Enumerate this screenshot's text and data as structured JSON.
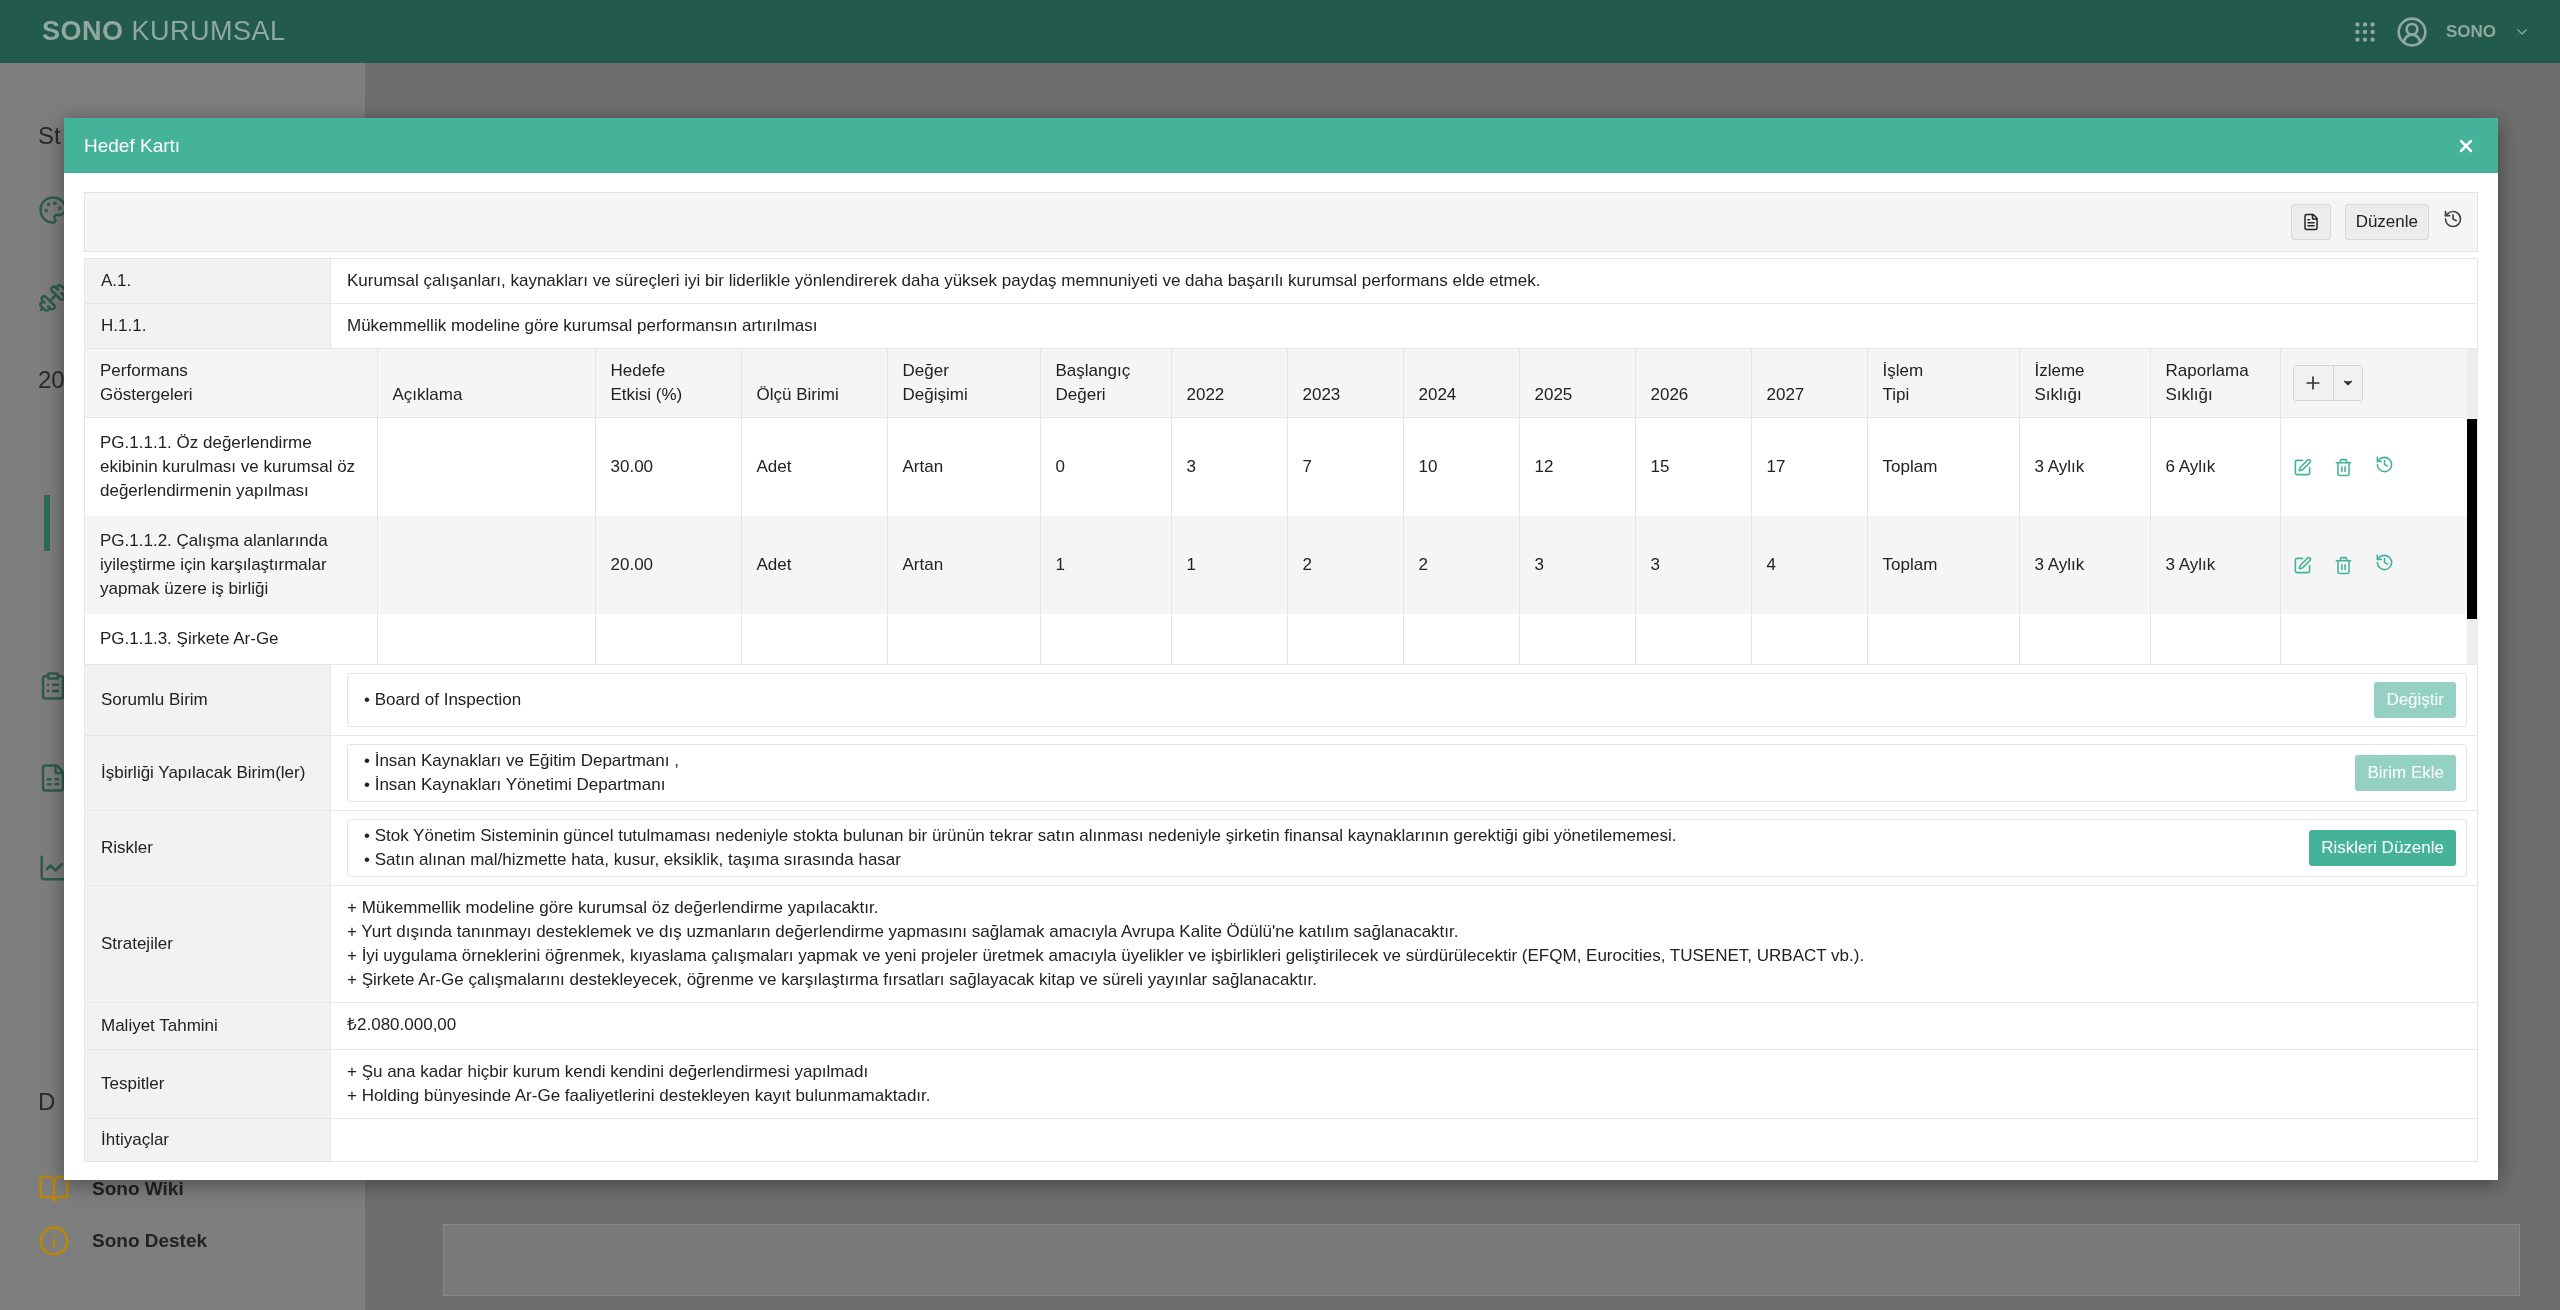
{
  "app_bar": {
    "brand_bold": "SONO",
    "brand_light": "KURUMSAL",
    "user": "SONO"
  },
  "sidebar": {
    "heading_top": "St",
    "year_text": "20",
    "heading_bottom": "D",
    "links": [
      "Sono Wiki",
      "Sono Destek"
    ]
  },
  "modal": {
    "title": "Hedef Kartı",
    "edit_button": "Düzenle",
    "goal_rows": [
      {
        "code": "A.1.",
        "text": "Kurumsal çalışanları, kaynakları ve süreçleri iyi bir liderlikle yönlendirerek daha yüksek paydaş memnuniyeti ve daha başarılı kurumsal performans elde etmek."
      },
      {
        "code": "H.1.1.",
        "text": "Mükemmellik modeline göre kurumsal performansın artırılması"
      }
    ],
    "indicator_columns": [
      "Performans\nGöstergeleri",
      "Açıklama",
      "Hedefe\nEtkisi (%)",
      "Ölçü Birimi",
      "Değer\nDeğişimi",
      "Başlangıç\nDeğeri",
      "2022",
      "2023",
      "2024",
      "2025",
      "2026",
      "2027",
      "İşlem\nTipi",
      "İzleme\nSıklığı",
      "Raporlama\nSıklığı"
    ],
    "indicator_rows": [
      {
        "name": "PG.1.1.1. Öz değerlendirme ekibinin kurulması ve kurumsal öz değerlendirmenin yapılması",
        "impact": "30.00",
        "unit": "Adet",
        "change": "Artan",
        "baseline": "0",
        "targets": [
          "3",
          "7",
          "10",
          "12",
          "15",
          "17"
        ],
        "operation": "Toplam",
        "monitoring": "3 Aylık",
        "reporting": "6 Aylık"
      },
      {
        "name": "PG.1.1.2. Çalışma alanlarında iyileştirme için karşılaştırmalar yapmak üzere iş birliği",
        "impact": "20.00",
        "unit": "Adet",
        "change": "Artan",
        "baseline": "1",
        "targets": [
          "1",
          "2",
          "2",
          "3",
          "3",
          "4"
        ],
        "operation": "Toplam",
        "monitoring": "3 Aylık",
        "reporting": "3 Aylık"
      },
      {
        "name": "PG.1.1.3. Şirkete Ar-Ge"
      }
    ],
    "details": [
      {
        "label": "Sorumlu Birim",
        "kind": "list",
        "items": [
          "• Board of Inspection"
        ],
        "button": {
          "label": "Değiştir",
          "disabled": true
        }
      },
      {
        "label": "İşbirliği Yapılacak Birim(ler)",
        "kind": "list",
        "items": [
          "• İnsan Kaynakları ve Eğitim Departmanı ,",
          "• İnsan Kaynakları Yönetimi Departmanı"
        ],
        "button": {
          "label": "Birim Ekle",
          "disabled": true
        }
      },
      {
        "label": "Riskler",
        "kind": "list",
        "items": [
          "• Stok Yönetim Sisteminin güncel tutulmaması nedeniyle stokta bulunan bir ürünün tekrar satın alınması nedeniyle şirketin finansal kaynaklarının gerektiği gibi yönetilememesi.",
          "• Satın alınan mal/hizmette hata, kusur, eksiklik, taşıma sırasında hasar"
        ],
        "button": {
          "label": "Riskleri Düzenle",
          "disabled": false
        }
      },
      {
        "label": "Stratejiler",
        "kind": "lines",
        "lines": [
          "+ Mükemmellik modeline göre kurumsal öz değerlendirme yapılacaktır.",
          "+ Yurt dışında tanınmayı desteklemek ve dış uzmanların değerlendirme yapmasını sağlamak amacıyla Avrupa Kalite Ödülü'ne katılım sağlanacaktır.",
          "+ İyi uygulama örneklerini öğrenmek, kıyaslama çalışmaları yapmak ve yeni projeler üretmek amacıyla üyelikler ve işbirlikleri geliştirilecek ve sürdürülecektir (EFQM, Eurocities, TUSENET, URBACT vb.).",
          "+ Şirkete Ar-Ge çalışmalarını destekleyecek, öğrenme ve karşılaştırma fırsatları sağlayacak kitap ve süreli yayınlar sağlanacaktır."
        ]
      },
      {
        "label": "Maliyet Tahmini",
        "kind": "lines",
        "lines": [
          "₺2.080.000,00"
        ]
      },
      {
        "label": "Tespitler",
        "kind": "lines",
        "lines": [
          "+ Şu ana kadar hiçbir kurum kendi kendini değerlendirmesi yapılmadı",
          "+ Holding bünyesinde Ar-Ge faaliyetlerini destekleyen kayıt bulunmamaktadır."
        ]
      },
      {
        "label": "İhtiyaçlar",
        "kind": "empty"
      }
    ]
  }
}
